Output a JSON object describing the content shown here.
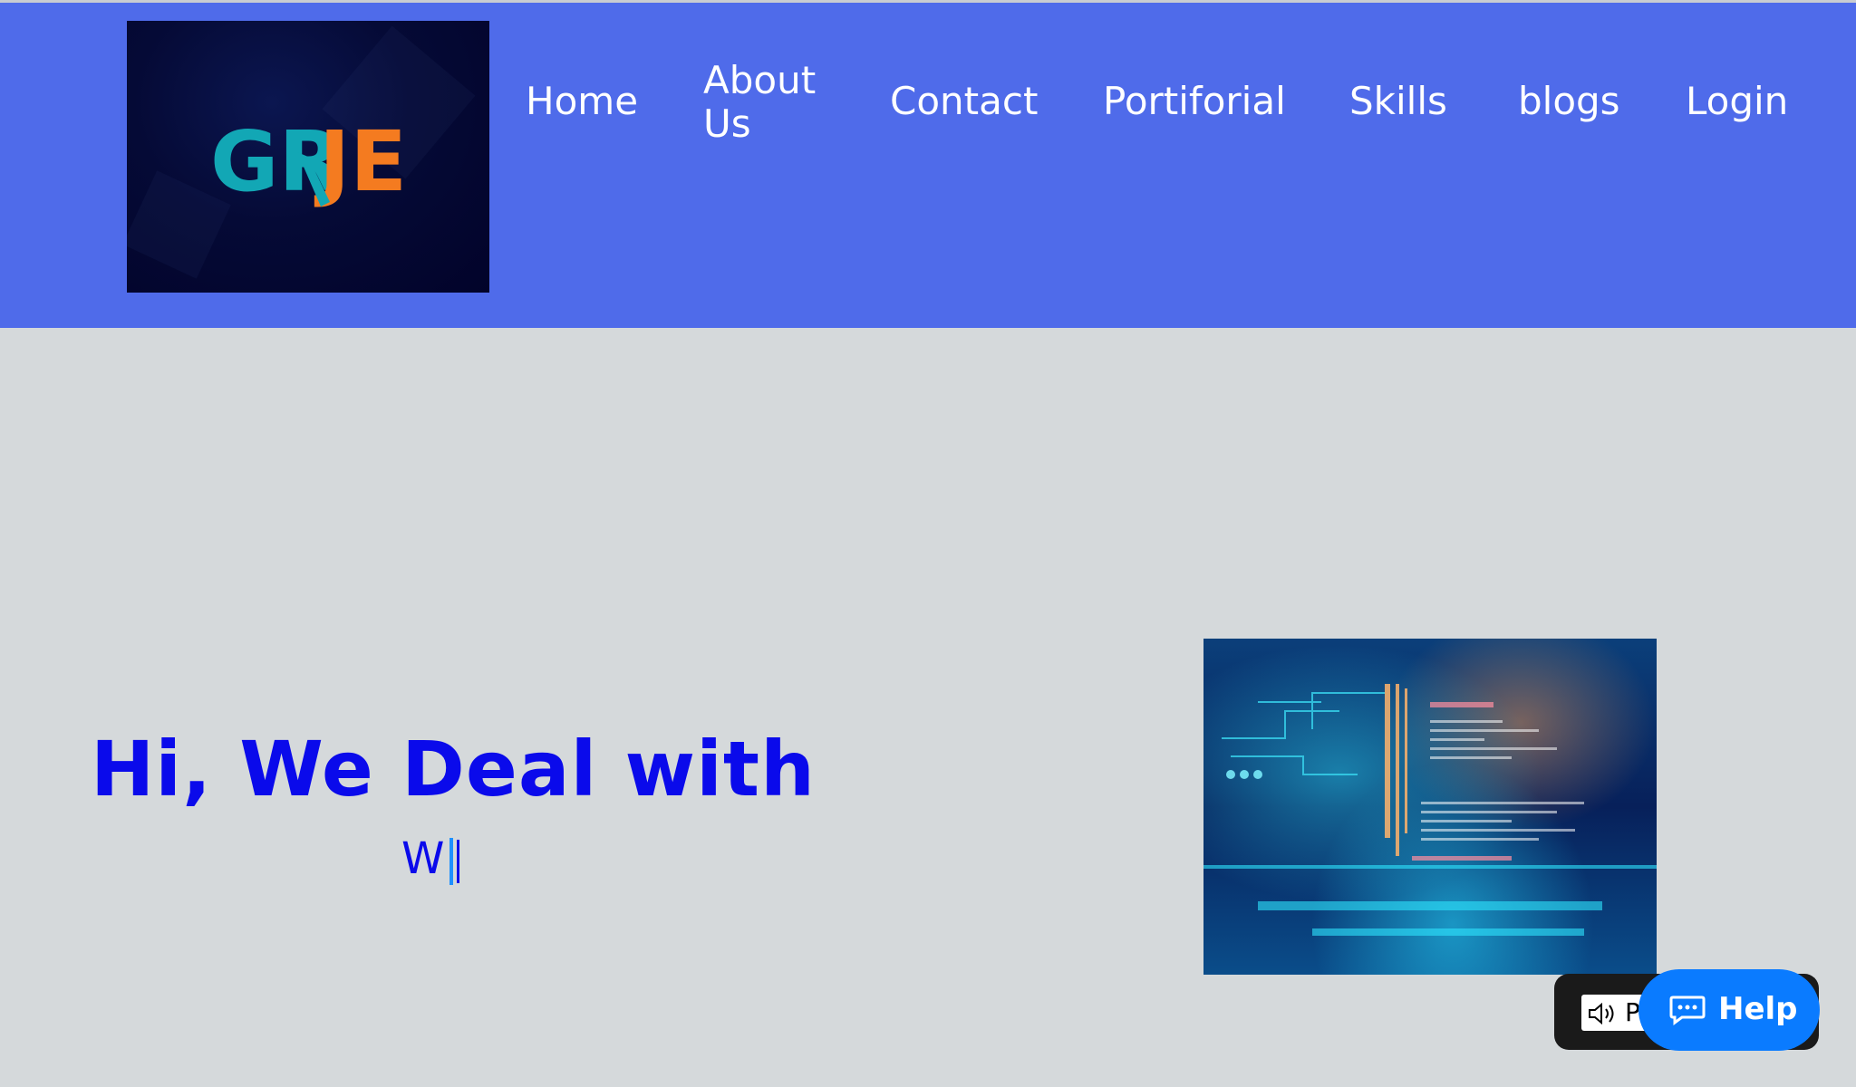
{
  "logo": {
    "text_gr": "GR",
    "text_je": "JE",
    "colors": {
      "teal": "#12a7b5",
      "orange": "#f47b20",
      "background": "#02032a"
    }
  },
  "nav": {
    "items": [
      {
        "label": "Home"
      },
      {
        "label": "About Us"
      },
      {
        "label": "Contact"
      },
      {
        "label": "Portiforial"
      },
      {
        "label": "Skills"
      },
      {
        "label": "blogs"
      },
      {
        "label": "Login"
      }
    ],
    "background": "#4f6bea"
  },
  "hero": {
    "title": "Hi, We Deal with",
    "typing_text": "W",
    "title_color": "#0a0aeb",
    "image_icon": "digital-code-illustration"
  },
  "widgets": {
    "reader_label": "P",
    "reader_icon": "speaker-icon",
    "help_label": "Help",
    "help_icon": "chat-bubble-icon",
    "help_color": "#0a7bff"
  }
}
